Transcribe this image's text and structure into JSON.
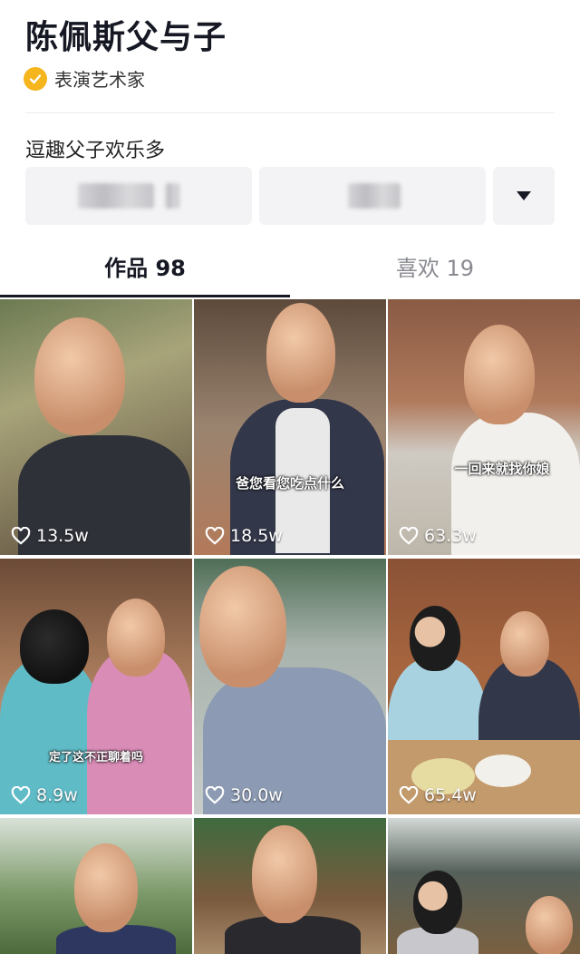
{
  "profile": {
    "name": "陈佩斯父与子",
    "verified_label": "表演艺术家",
    "bio": "逗趣父子欢乐多"
  },
  "tabs": [
    {
      "label": "作品 98",
      "active": true
    },
    {
      "label": "喜欢 19",
      "active": false
    }
  ],
  "videos": [
    {
      "likes": "13.5w",
      "caption": ""
    },
    {
      "likes": "18.5w",
      "caption": "爸您看您吃点什么"
    },
    {
      "likes": "63.3w",
      "caption": "一回来就找你娘"
    },
    {
      "likes": "8.9w",
      "caption": "定了这不正聊着吗"
    },
    {
      "likes": "30.0w",
      "caption": ""
    },
    {
      "likes": "65.4w",
      "caption": ""
    },
    {
      "likes": "",
      "caption": ""
    },
    {
      "likes": "",
      "caption": ""
    },
    {
      "likes": "",
      "caption": ""
    }
  ],
  "colors": {
    "verified_badge": "#f5b51c",
    "active_tab": "#161823",
    "inactive_tab": "#8a8b91"
  },
  "icons": {
    "verified": "check-badge-icon",
    "dropdown": "caret-down-icon",
    "likes": "heart-outline-icon"
  }
}
